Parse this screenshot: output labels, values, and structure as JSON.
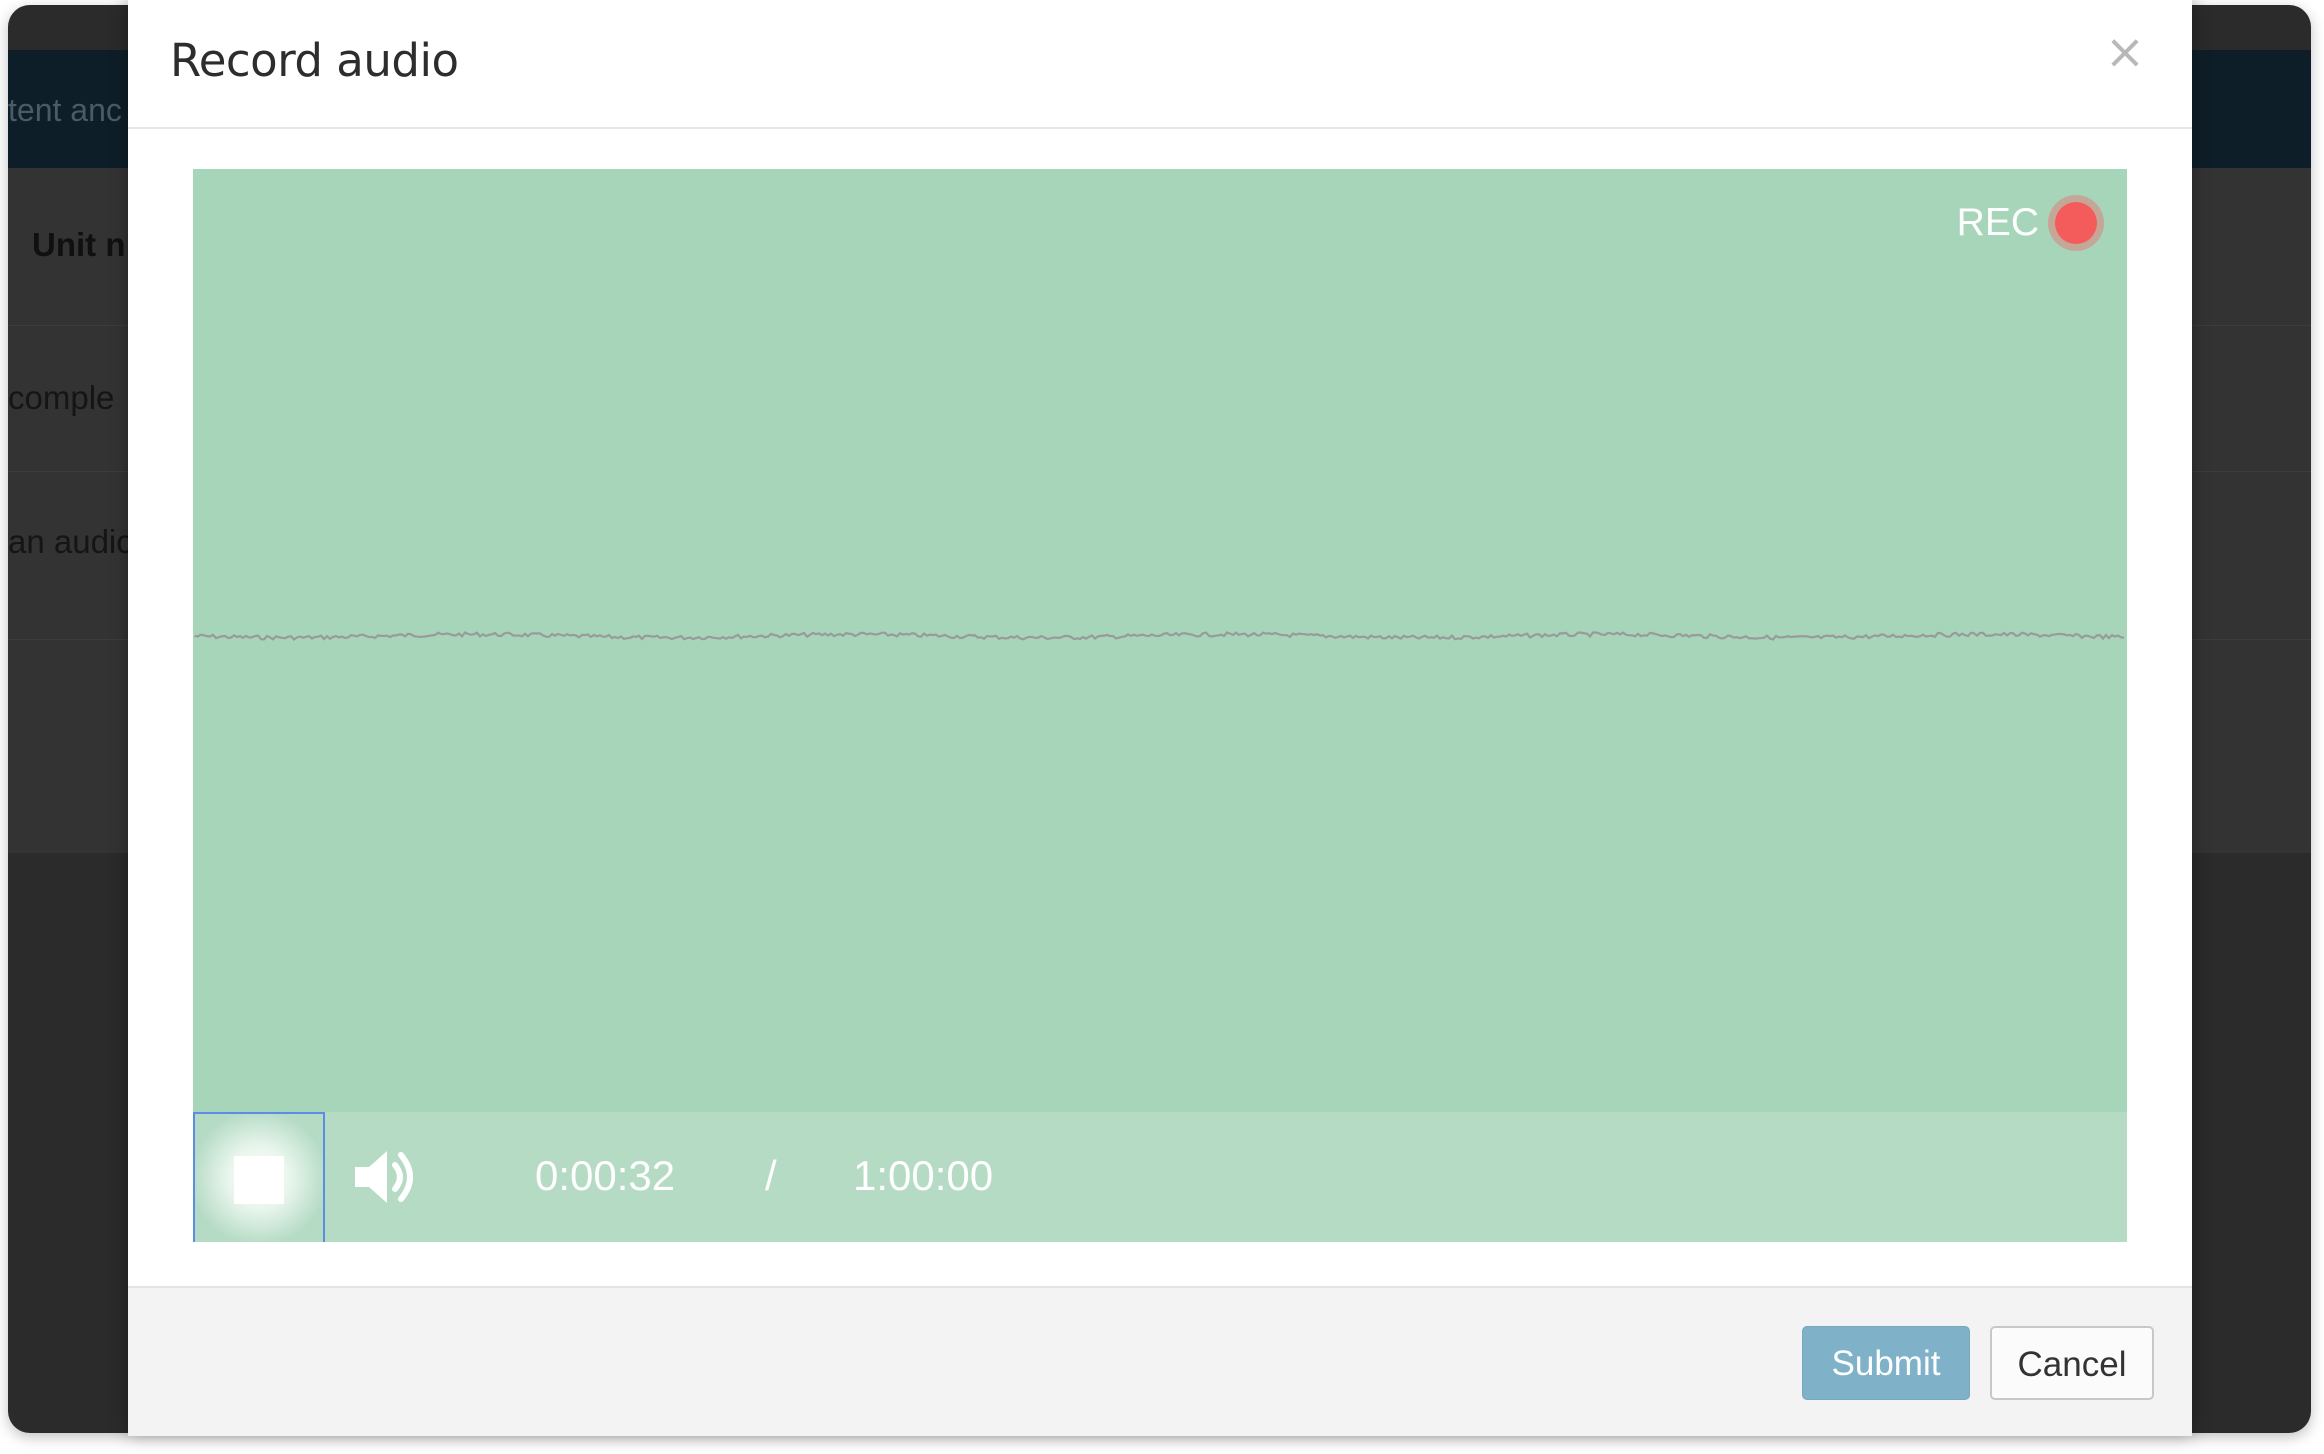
{
  "background": {
    "header_text": "tent anc",
    "table": {
      "header_cell": "Unit n",
      "row1_cell": "comple",
      "row2_cell": "an audic"
    }
  },
  "modal": {
    "title": "Record audio",
    "close_label": "×",
    "recorder": {
      "rec_label": "REC",
      "current_time": "0:00:32",
      "separator": "/",
      "max_time": "1:00:00",
      "stop_icon": "stop-icon",
      "volume_icon": "speaker-volume-icon",
      "colors": {
        "canvas": "#a7d5b9",
        "controls": "#b5dbc5",
        "rec_dot": "#f45b5b",
        "waveform": "#9a9a9a"
      }
    },
    "footer": {
      "submit_label": "Submit",
      "cancel_label": "Cancel",
      "submit_color": "#7fb2c8"
    }
  }
}
